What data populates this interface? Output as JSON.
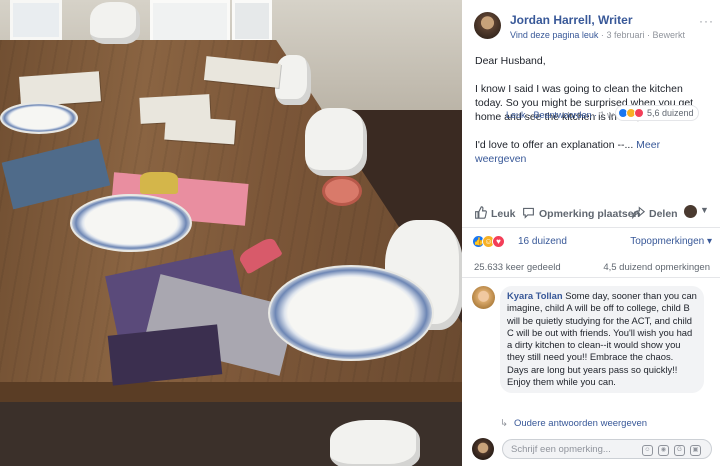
{
  "post": {
    "author": "Jordan Harrell, Writer",
    "like_page": "Vind deze pagina leuk",
    "separator": "·",
    "date": "3 februari",
    "edited": "Bewerkt",
    "more_dots": "···",
    "body": {
      "greeting": "Dear Husband,",
      "paragraph1": "I know I said I was going to clean the kitchen today. So you might be surprised when you get home and see the kitchen is in fact, not clean.",
      "paragraph2": "I'd love to offer an explanation --...",
      "see_more": "Meer weergeven"
    }
  },
  "actions": {
    "like": "Leuk",
    "comment": "Opmerking plaatsen",
    "share": "Delen"
  },
  "reactions": {
    "count": "16 duizend",
    "top_comments": "Topopmerkingen ▾",
    "icons": [
      "like-icon",
      "haha-icon",
      "love-icon"
    ]
  },
  "stats": {
    "shares": "25.633 keer gedeeld",
    "comments": "4,5 duizend opmerkingen"
  },
  "comment": {
    "name": "Kyara Tollan",
    "text": "Some day, sooner than you can imagine, child A will be off to college, child B will be quietly studying for the ACT, and child C will be out with friends. You'll wish you had a dirty kitchen to clean--it would show you they still need you!! Embrace the chaos. Days are long but years pass so quickly!! Enjoy them while you can.",
    "like": "Leuk",
    "reply": "Beantwoorden",
    "time": "1 w",
    "reaction_count": "5,6 duizend"
  },
  "older_replies": "Oudere antwoorden weergeven",
  "composer": {
    "placeholder": "Schrijf een opmerking..."
  },
  "colors": {
    "link": "#385898",
    "like_blue": "#1877f2",
    "love_red": "#f33e58",
    "haha_yellow": "#f7b125"
  }
}
